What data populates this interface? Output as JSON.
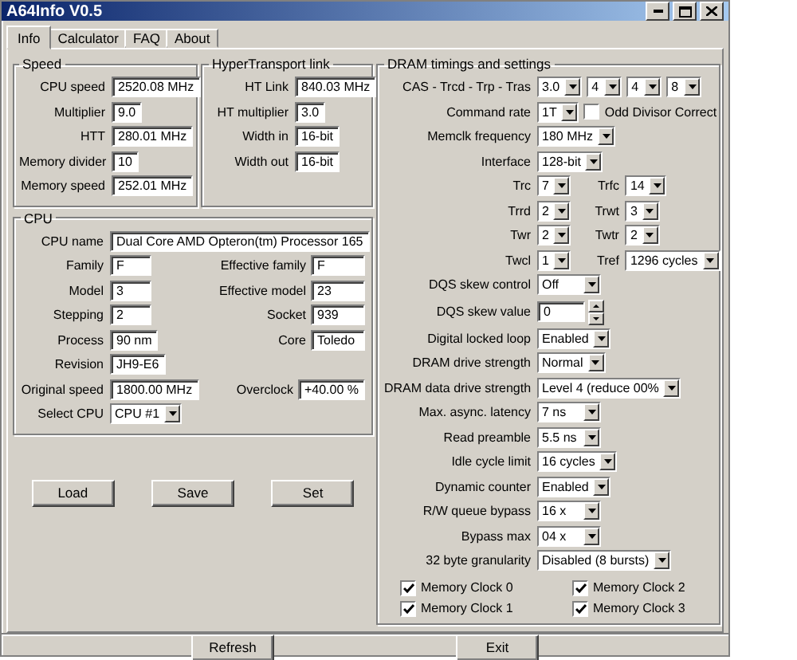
{
  "window": {
    "title": "A64Info V0.5"
  },
  "tabs": [
    {
      "label": "Info",
      "selected": true
    },
    {
      "label": "Calculator",
      "selected": false
    },
    {
      "label": "FAQ",
      "selected": false
    },
    {
      "label": "About",
      "selected": false
    }
  ],
  "speed": {
    "title": "Speed",
    "rows": [
      {
        "label": "CPU speed",
        "value": "2520.08 MHz"
      },
      {
        "label": "Multiplier",
        "value": "9.0"
      },
      {
        "label": "HTT",
        "value": "280.01 MHz"
      },
      {
        "label": "Memory divider",
        "value": "10"
      },
      {
        "label": "Memory speed",
        "value": "252.01 MHz"
      }
    ]
  },
  "ht": {
    "title": "HyperTransport link",
    "rows": [
      {
        "label": "HT Link",
        "value": "840.03 MHz"
      },
      {
        "label": "HT multiplier",
        "value": "3.0"
      },
      {
        "label": "Width in",
        "value": "16-bit"
      },
      {
        "label": "Width out",
        "value": "16-bit"
      }
    ]
  },
  "cpu": {
    "title": "CPU",
    "name": {
      "label": "CPU name",
      "value": "Dual Core AMD Opteron(tm) Processor 165"
    },
    "rows": [
      {
        "left": {
          "label": "Family",
          "value": "F"
        },
        "right": {
          "label": "Effective family",
          "value": "F"
        }
      },
      {
        "left": {
          "label": "Model",
          "value": "3"
        },
        "right": {
          "label": "Effective model",
          "value": "23"
        }
      },
      {
        "left": {
          "label": "Stepping",
          "value": "2"
        },
        "right": {
          "label": "Socket",
          "value": "939"
        }
      },
      {
        "left": {
          "label": "Process",
          "value": "90 nm"
        },
        "right": {
          "label": "Core",
          "value": "Toledo"
        }
      },
      {
        "left": {
          "label": "Revision",
          "value": "JH9-E6"
        }
      },
      {
        "left": {
          "label": "Original speed",
          "value": "1800.00 MHz"
        },
        "right": {
          "label": "Overclock",
          "value": "+40.00 %"
        }
      }
    ],
    "select": {
      "label": "Select CPU",
      "value": "CPU #1"
    }
  },
  "actions": [
    "Load",
    "Save",
    "Set"
  ],
  "dram": {
    "title": "DRAM timings and settings",
    "rows": [
      {
        "kind": "multi",
        "label": "CAS - Trcd - Trp - Tras",
        "values": [
          "3.0",
          "4",
          "4",
          "8"
        ]
      },
      {
        "kind": "combo-check",
        "label": "Command rate",
        "value": "1T",
        "check": {
          "label": "Odd Divisor Correct",
          "checked": false
        }
      },
      {
        "kind": "combo",
        "label": "Memclk frequency",
        "value": "180 MHz"
      },
      {
        "kind": "combo",
        "label": "Interface",
        "value": "128-bit"
      },
      {
        "kind": "pair",
        "items": [
          {
            "label": "Trc",
            "value": "7"
          },
          {
            "label": "Trfc",
            "value": "14"
          }
        ]
      },
      {
        "kind": "pair",
        "items": [
          {
            "label": "Trrd",
            "value": "2"
          },
          {
            "label": "Trwt",
            "value": "3"
          }
        ]
      },
      {
        "kind": "pair",
        "items": [
          {
            "label": "Twr",
            "value": "2"
          },
          {
            "label": "Twtr",
            "value": "2"
          }
        ]
      },
      {
        "kind": "pair",
        "items": [
          {
            "label": "Twcl",
            "value": "1"
          },
          {
            "label": "Tref",
            "value": "1296 cycles"
          }
        ]
      },
      {
        "kind": "combo",
        "label": "DQS skew control",
        "value": "Off"
      },
      {
        "kind": "spin",
        "label": "DQS skew value",
        "value": "0"
      },
      {
        "kind": "combo",
        "label": "Digital locked loop",
        "value": "Enabled"
      },
      {
        "kind": "combo",
        "label": "DRAM drive strength",
        "value": "Normal"
      },
      {
        "kind": "combo",
        "label": "DRAM data drive strength",
        "value": "Level 4 (reduce 00%"
      },
      {
        "kind": "combo",
        "label": "Max. async. latency",
        "value": "7 ns"
      },
      {
        "kind": "combo",
        "label": "Read preamble",
        "value": "5.5 ns"
      },
      {
        "kind": "combo",
        "label": "Idle cycle limit",
        "value": "16 cycles"
      },
      {
        "kind": "combo",
        "label": "Dynamic counter",
        "value": "Enabled"
      },
      {
        "kind": "combo",
        "label": "R/W queue bypass",
        "value": "16 x"
      },
      {
        "kind": "combo",
        "label": "Bypass max",
        "value": "04 x"
      },
      {
        "kind": "combo",
        "label": "32 byte granularity",
        "value": "Disabled (8 bursts)"
      }
    ],
    "memory_clocks": [
      {
        "label": "Memory Clock 0",
        "checked": true
      },
      {
        "label": "Memory Clock 2",
        "checked": true
      },
      {
        "label": "Memory Clock 1",
        "checked": true
      },
      {
        "label": "Memory Clock 3",
        "checked": true
      }
    ]
  },
  "bottom_buttons": [
    "Refresh",
    "Exit"
  ]
}
